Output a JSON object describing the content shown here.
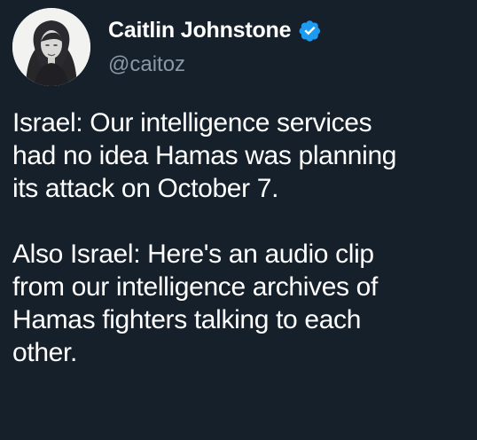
{
  "author": {
    "display_name": "Caitlin Johnstone",
    "handle": "@caitoz",
    "avatar_icon": "avatar-portrait",
    "verified_icon": "verified-badge-icon"
  },
  "colors": {
    "background": "#15202b",
    "text": "#ffffff",
    "secondary_text": "#8b98a5",
    "verified": "#1d9bf0"
  },
  "tweet": {
    "paragraph_1": "Israel: Our intelligence services\nhad no idea Hamas was planning\nits attack on October 7.",
    "paragraph_2": "Also Israel: Here's an audio clip\nfrom our intelligence archives of\nHamas fighters talking to each\nother."
  }
}
